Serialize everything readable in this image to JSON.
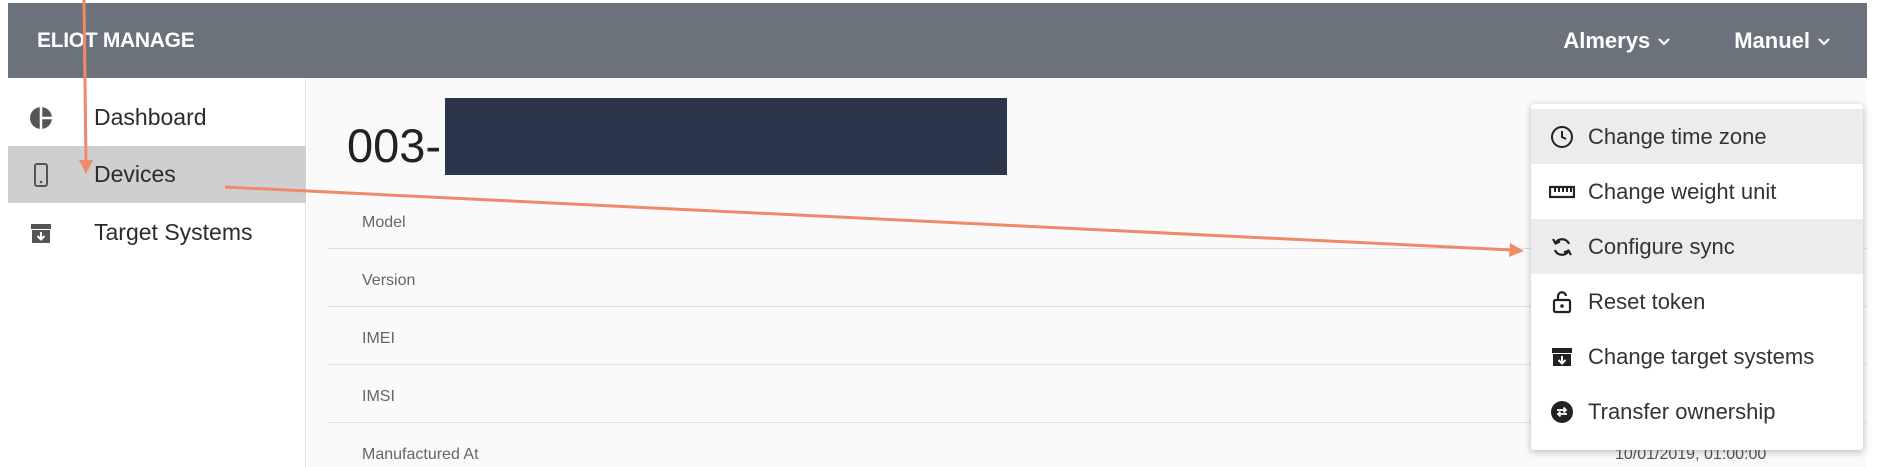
{
  "header": {
    "brand": "ELIOT MANAGE",
    "menus": [
      {
        "label": "Almerys",
        "icon": "chevron-down-icon"
      },
      {
        "label": "Manuel",
        "icon": "chevron-down-icon"
      }
    ]
  },
  "sidebar": {
    "items": [
      {
        "label": "Dashboard",
        "icon": "pie-chart-icon",
        "active": false
      },
      {
        "label": "Devices",
        "icon": "mobile-phone-icon",
        "active": true
      },
      {
        "label": "Target Systems",
        "icon": "archive-box-icon",
        "active": false
      }
    ]
  },
  "device": {
    "title": "003-",
    "fields": [
      {
        "label": "Model",
        "value": ""
      },
      {
        "label": "Version",
        "value": ""
      },
      {
        "label": "IMEI",
        "value": ""
      },
      {
        "label": "IMSI",
        "value": ""
      },
      {
        "label": "Manufactured At",
        "value": "10/01/2019, 01:00:00"
      }
    ]
  },
  "actions_menu": {
    "items": [
      {
        "label": "Change time zone",
        "icon": "clock-icon",
        "highlighted": true
      },
      {
        "label": "Change weight unit",
        "icon": "ruler-icon",
        "highlighted": false
      },
      {
        "label": "Configure sync",
        "icon": "sync-icon",
        "highlighted": true
      },
      {
        "label": "Reset token",
        "icon": "unlock-icon",
        "highlighted": false
      },
      {
        "label": "Change target systems",
        "icon": "archive-box-icon",
        "highlighted": false
      },
      {
        "label": "Transfer ownership",
        "icon": "exchange-icon",
        "highlighted": false
      }
    ]
  },
  "colors": {
    "header_bg": "#6b727b",
    "annotation_arrow": "#ee8a6a",
    "redaction": "#2c364a",
    "active_bg": "#cfcfcf"
  }
}
